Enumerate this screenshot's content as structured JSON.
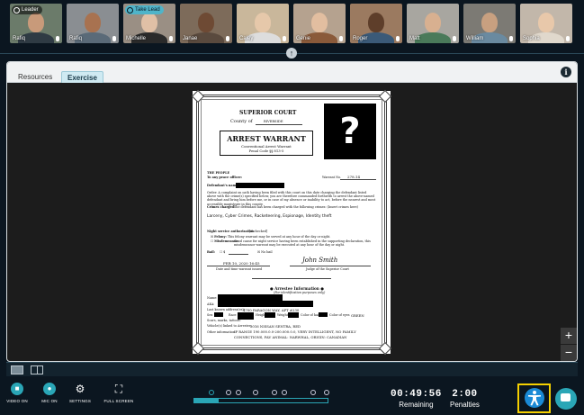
{
  "participants": [
    {
      "name": "Rafiq",
      "badge": "Leader"
    },
    {
      "name": "Rafiq",
      "badge": ""
    },
    {
      "name": "Michelle",
      "badge": "Take Lead"
    },
    {
      "name": "Janae",
      "badge": ""
    },
    {
      "name": "Caley",
      "badge": ""
    },
    {
      "name": "Genie",
      "badge": ""
    },
    {
      "name": "Roger",
      "badge": ""
    },
    {
      "name": "Matt",
      "badge": ""
    },
    {
      "name": "William",
      "badge": ""
    },
    {
      "name": "Sophia",
      "badge": ""
    }
  ],
  "tabs": {
    "resources": "Resources",
    "exercise": "Exercise"
  },
  "document": {
    "court": "SUPERIOR COURT",
    "county_label": "County of",
    "county": "RIVERSIDE",
    "warrant_title": "ARREST WARRANT",
    "warrant_sub1": "Conventional Arrest Warrant",
    "warrant_sub2": "Penal Code §§ 813-5",
    "people": "THE PEOPLE",
    "to_any": "To any peace officer:",
    "warrant_no_label": "Warrant No.",
    "warrant_no": "278.14",
    "defendant_label": "Defendant's name:",
    "order_text": "Order: A complaint on oath having been filed with this court on this date charging the defendant listed above with the crime(s) specified below, you are therefore commanded forthwith to arrest the above-named defendant and bring him before me, or in case of my absence or inability to act, before the nearest and most accessible magistrate in this county.",
    "crimes_label": "Crimes charged:",
    "crimes_note": "The defendant has been charged with the following crimes: (Insert crimes here)",
    "crimes": "Larceny, Cyber Crimes, Racketeering, Espionage, Identity theft",
    "night_label": "Night service authorization",
    "night_check": "[if checked]",
    "felony": "Felony:",
    "felony_text": "This felony warrant may be served at any hour of the day or night.",
    "misdemeanor": "Misdemeanor:",
    "misdemeanor_text": "Good cause for night service having been established in the supporting declaration, this misdemeanor warrant may be executed at any hour of the day or night.",
    "bail_label": "Bail:",
    "bail_amount": "$",
    "no_bail": "No bail",
    "date_issued": "FEB 10, 2020  16:45",
    "date_caption": "Date and time warrant issued",
    "judge_caption": "Judge of the Superior Court",
    "signature": "John Smith",
    "arrestee_title": "● Arrestee Information ●",
    "arrestee_sub": "(For identification purposes only)",
    "name_label": "Name:",
    "aka_label": "AKA:",
    "address_label": "Last known address(es):",
    "address": "4700 PARAGON WAY, APT #230",
    "sex_label": "Sex",
    "race_label": "Race",
    "height_label": "Height",
    "weight_label": "Weight",
    "hair_label": "Color of hair",
    "eyes_label": "Color of eyes",
    "eyes": "GREEN",
    "scars_label": "Scars, marks, tattoos:",
    "vehicle_label": "Vehicle(s) linked to Arrestee:",
    "vehicle": "2016 NISSAN SENTRA, RED",
    "other_label": "Other information:",
    "other1": "IP RANGE 190.000.0.0-200.000.0.0, VERY INTELLIGENT, NO FAMILY",
    "other2": "CONNECTIONS, FAV ANIMAL: NARWHAL, ORIGIN: CANADIAN",
    "photo_placeholder": "?"
  },
  "zoom": {
    "plus": "+",
    "minus": "−"
  },
  "controls": {
    "video": "VIDEO ON",
    "mic": "MIC ON",
    "settings": "SETTINGS",
    "fullscreen": "FULL SCREEN"
  },
  "progress": {
    "fraction": 0.18
  },
  "timers": {
    "remaining_value": "00:49:56",
    "remaining_label": "Remaining",
    "penalties_value": "2:00",
    "penalties_label": "Penalties"
  },
  "colors": {
    "accent": "#2aa6b6",
    "accessibility_border": "#f5d000",
    "accessibility": "#1a8ad6"
  },
  "icons": {
    "info": "i",
    "collapse": "↑",
    "settings": "⚙",
    "fullscreen": "⛶"
  }
}
